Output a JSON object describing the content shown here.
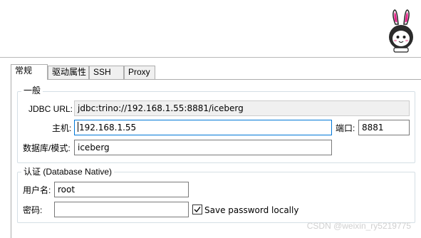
{
  "tabs": [
    {
      "label": "常规",
      "active": true
    },
    {
      "label": "驱动属性",
      "active": false
    },
    {
      "label": "SSH",
      "active": false
    },
    {
      "label": "Proxy",
      "active": false
    }
  ],
  "general": {
    "title": "一般",
    "jdbc_label": "JDBC URL:",
    "jdbc_value": "jdbc:trino://192.168.1.55:8881/iceberg",
    "host_label": "主机:",
    "host_value": "192.168.1.55",
    "port_label": "端口:",
    "port_value": "8881",
    "database_label": "数据库/模式:",
    "database_value": "iceberg"
  },
  "auth": {
    "title": "认证 (Database Native)",
    "username_label": "用户名:",
    "username_value": "root",
    "password_label": "密码:",
    "password_value": "",
    "save_password_label": "Save password locally",
    "save_password_checked": true
  },
  "watermark": "CSDN @weixin_ry5219775",
  "mascot_icon": "bunny-astronaut-icon",
  "colors": {
    "focus_border": "#0078d7",
    "readonly_bg": "#f0f0f0",
    "group_border": "#d5dfe5"
  }
}
